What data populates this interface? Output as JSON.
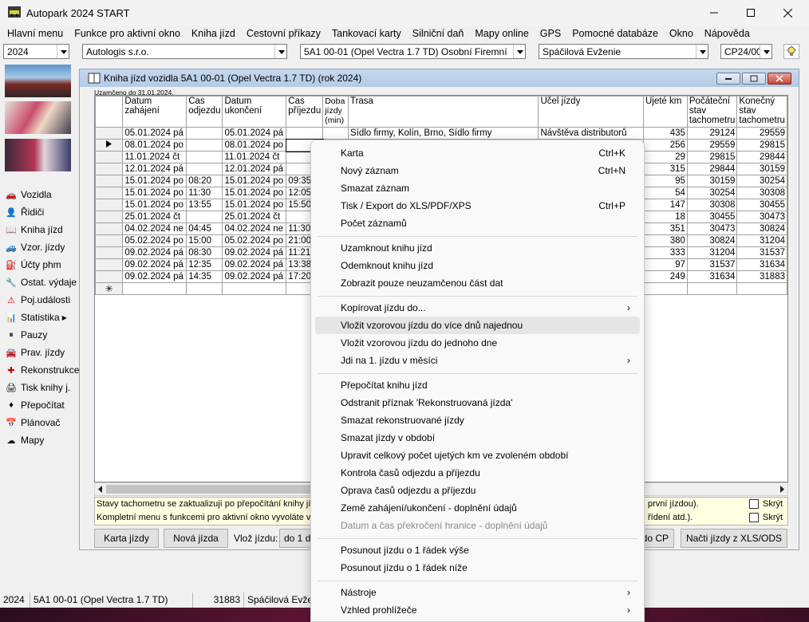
{
  "window": {
    "title": "Autopark 2024 START"
  },
  "menu": [
    "Hlavní menu",
    "Funkce pro aktivní okno",
    "Kniha jízd",
    "Cestovní příkazy",
    "Tankovací karty",
    "Silniční daň",
    "Mapy online",
    "GPS",
    "Pomocné databáze",
    "Okno",
    "Nápověda"
  ],
  "toolbar": {
    "year": "2024",
    "company": "Autologis s.r.o.",
    "vehicle": "5A1 00-01 (Opel Vectra 1.7 TD) Osobní Firemní",
    "driver": "Spáčilová Evženie",
    "code": "CP24/00"
  },
  "nav": [
    "Vozidla",
    "Řidiči",
    "Kniha jízd",
    "Vzor. jízdy",
    "Účty phm",
    "Ostat. výdaje",
    "Poj.události",
    "Statistika",
    "Pauzy",
    "Prav. jízdy",
    "Rekonstrukce",
    "Tisk knihy j.",
    "Přepočítat",
    "Plánovač",
    "Mapy"
  ],
  "doc": {
    "title": "Kniha jízd vozidla  5A1 00-01 (Opel Vectra 1.7 TD) (rok 2024)",
    "locked_note": "Uzamčeno do 31.01.2024.",
    "columns": [
      "Datum zahájení",
      "Čas odjezdu",
      "Datum ukončení",
      "Čas příjezdu",
      "Doba jízdy (min)",
      "Trasa",
      "Účel jízdy",
      "Ujeté km",
      "Počáteční stav tachometru",
      "Konečný stav tachometru"
    ],
    "rows": [
      [
        "05.01.2024 pá",
        "",
        "05.01.2024 pá",
        "",
        "",
        "Sídlo firmy, Kolín, Brno, Sídlo firmy",
        "Návštěva distributorů",
        "435",
        "29124",
        "29559"
      ],
      [
        "08.01.2024 po",
        "",
        "08.01.2024 po",
        "",
        "",
        "",
        "",
        "256",
        "29559",
        "29815"
      ],
      [
        "11.01.2024 čt",
        "",
        "11.01.2024 čt",
        "",
        "",
        "",
        "",
        "29",
        "29815",
        "29844"
      ],
      [
        "12.01.2024 pá",
        "",
        "12.01.2024 pá",
        "",
        "",
        "",
        "",
        "315",
        "29844",
        "30159"
      ],
      [
        "15.01.2024 po",
        "08:20",
        "15.01.2024 po",
        "09:35",
        "",
        "",
        "",
        "95",
        "30159",
        "30254"
      ],
      [
        "15.01.2024 po",
        "11:30",
        "15.01.2024 po",
        "12:05",
        "",
        "",
        "",
        "54",
        "30254",
        "30308"
      ],
      [
        "15.01.2024 po",
        "13:55",
        "15.01.2024 po",
        "15:50",
        "",
        "",
        "",
        "147",
        "30308",
        "30455"
      ],
      [
        "25.01.2024 čt",
        "",
        "25.01.2024 čt",
        "",
        "",
        "",
        "",
        "18",
        "30455",
        "30473"
      ],
      [
        "04.02.2024 ne",
        "04:45",
        "04.02.2024 ne",
        "11:30",
        "",
        "",
        "",
        "351",
        "30473",
        "30824"
      ],
      [
        "05.02.2024 po",
        "15:00",
        "05.02.2024 po",
        "21:00",
        "",
        "",
        "",
        "380",
        "30824",
        "31204"
      ],
      [
        "09.02.2024 pá",
        "08:30",
        "09.02.2024 pá",
        "11:21",
        "",
        "",
        "",
        "333",
        "31204",
        "31537"
      ],
      [
        "09.02.2024 pá",
        "12:35",
        "09.02.2024 pá",
        "13:38",
        "",
        "",
        "",
        "97",
        "31537",
        "31634"
      ],
      [
        "09.02.2024 pá",
        "14:35",
        "09.02.2024 pá",
        "17:20",
        "",
        "",
        "",
        "249",
        "31634",
        "31883"
      ]
    ],
    "info_line1": "Stavy tachometru se zaktualizují po přepočítání knihy jízd",
    "info_line2": "Kompletní menu s funkcemi pro aktivní okno vyvoláte v t",
    "info_right1": "první jízdou).",
    "info_right2": "řídení atd.).",
    "hide_label": "Skrýt",
    "buttons": {
      "karta": "Karta jízdy",
      "nova": "Nová jízda",
      "vloz_label": "Vlož jízdu:",
      "vloz_partial": "do 1 dr",
      "do_cp": "do CP",
      "nacti": "Načti jízdy z XLS/ODS"
    }
  },
  "status": {
    "year": "2024",
    "vehicle": "5A1 00-01 (Opel Vectra 1.7 TD)",
    "km": "31883",
    "driver": "Spáčilová Evžen"
  },
  "context_menu": {
    "items": [
      {
        "label": "Karta",
        "shortcut": "Ctrl+K"
      },
      {
        "label": "Nový záznam",
        "shortcut": "Ctrl+N"
      },
      {
        "label": "Smazat záznam",
        "shortcut": ""
      },
      {
        "label": "Tisk / Export do XLS/PDF/XPS",
        "shortcut": "Ctrl+P"
      },
      {
        "label": "Počet záznamů",
        "shortcut": ""
      },
      {
        "label": "Uzamknout knihu jízd",
        "shortcut": ""
      },
      {
        "label": "Odemknout knihu jízd",
        "shortcut": ""
      },
      {
        "label": "Zobrazit pouze neuzamčenou část dat",
        "shortcut": ""
      },
      {
        "label": "Kopírovat jízdu do...",
        "shortcut": ""
      },
      {
        "label": "Vložit vzorovou jízdu do více dnů najednou",
        "shortcut": ""
      },
      {
        "label": "Vložit vzorovou jízdu do jednoho dne",
        "shortcut": ""
      },
      {
        "label": "Jdi na 1. jízdu v měsíci",
        "shortcut": ""
      },
      {
        "label": "Přepočítat knihu jízd",
        "shortcut": ""
      },
      {
        "label": "Odstranit příznak 'Rekonstruovaná jízda'",
        "shortcut": ""
      },
      {
        "label": "Smazat rekonstruované jízdy",
        "shortcut": ""
      },
      {
        "label": "Smazat jízdy v období",
        "shortcut": ""
      },
      {
        "label": "Upravit celkový počet ujetých km ve zvoleném období",
        "shortcut": ""
      },
      {
        "label": "Kontrola časů odjezdu a příjezdu",
        "shortcut": ""
      },
      {
        "label": "Oprava časů odjezdu a příjezdu",
        "shortcut": ""
      },
      {
        "label": "Země zahájení/ukončení - doplnění údajů",
        "shortcut": ""
      },
      {
        "label": "Datum a  čas překročení hranice - doplnění údajů",
        "shortcut": ""
      },
      {
        "label": "Posunout jízdu o 1 řádek výše",
        "shortcut": ""
      },
      {
        "label": "Posunout jízdu o 1 řádek níže",
        "shortcut": ""
      },
      {
        "label": "Nástroje",
        "shortcut": ""
      },
      {
        "label": "Vzhled prohlížeče",
        "shortcut": ""
      }
    ]
  }
}
